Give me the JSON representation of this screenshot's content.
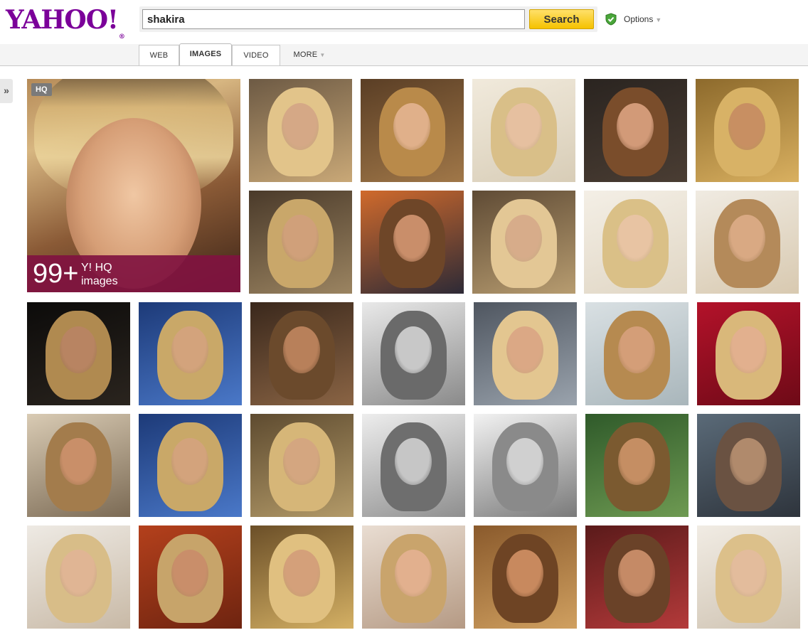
{
  "header": {
    "logo_text": "YAHOO!",
    "logo_reg": "®",
    "search": {
      "value": "shakira",
      "button_label": "Search"
    },
    "options_label": "Options"
  },
  "tabs": [
    {
      "label": "WEB",
      "active": false
    },
    {
      "label": "IMAGES",
      "active": true
    },
    {
      "label": "VIDEO",
      "active": false
    },
    {
      "label": "MORE",
      "active": false
    }
  ],
  "sidebar_toggle": "»",
  "hq_tile": {
    "badge": "HQ",
    "count": "99+",
    "label_line1": "Y! HQ",
    "label_line2": "images"
  },
  "colors": {
    "brand": "#7b0099",
    "search_button": "#f5c200",
    "hq_banner": "#801240"
  },
  "image_results": {
    "rows": [
      {
        "thumbs": [
          {
            "bg": [
              "#6d5a44",
              "#c9a877"
            ],
            "skin": "#d5a886",
            "hair": "#e2c48a"
          },
          {
            "bg": [
              "#5a3e25",
              "#a07748"
            ],
            "skin": "#e0b08a",
            "hair": "#b98a4a"
          },
          {
            "bg": [
              "#f1eadc",
              "#d8cdb7"
            ],
            "skin": "#e6c0a0",
            "hair": "#d9bf88"
          },
          {
            "bg": [
              "#2a2420",
              "#4a3d33"
            ],
            "skin": "#d29a78",
            "hair": "#7a4d2b"
          },
          {
            "bg": [
              "#8d6a2c",
              "#d9b060"
            ],
            "skin": "#c88f62",
            "hair": "#d8b266"
          }
        ]
      },
      {
        "thumbs": [
          {
            "bg": [
              "#4a3a2a",
              "#9b8461"
            ],
            "skin": "#d0a07a",
            "hair": "#c9a76a"
          },
          {
            "bg": [
              "#d06a2c",
              "#2d2a36"
            ],
            "skin": "#c98e6a",
            "hair": "#6e4628"
          },
          {
            "bg": [
              "#5f4b35",
              "#b79c70"
            ],
            "skin": "#d7ac8a",
            "hair": "#e3c795"
          },
          {
            "bg": [
              "#f4efe6",
              "#e0d6c4"
            ],
            "skin": "#e8c4a3",
            "hair": "#dac087"
          },
          {
            "bg": [
              "#f0ebe2",
              "#d8c9b0"
            ],
            "skin": "#d9a983",
            "hair": "#b48a5a"
          }
        ]
      },
      {
        "thumbs": [
          {
            "bg": [
              "#0c0b0a",
              "#2a241e"
            ],
            "skin": "#b88462",
            "hair": "#b08a50"
          },
          {
            "bg": [
              "#1d3a78",
              "#4a78c8"
            ],
            "skin": "#d3a37c",
            "hair": "#c9a868"
          },
          {
            "bg": [
              "#3a281c",
              "#8a6444"
            ],
            "skin": "#b8805a",
            "hair": "#6b4a2c"
          },
          {
            "bg": [
              "#e9e9e9",
              "#8a8a8a"
            ],
            "skin": "#c8c8c8",
            "hair": "#6a6a6a"
          },
          {
            "bg": [
              "#4f5660",
              "#9aa3ad"
            ],
            "skin": "#dba885",
            "hair": "#e3c690"
          },
          {
            "bg": [
              "#d9e0e3",
              "#a9b6bb"
            ],
            "skin": "#d49e78",
            "hair": "#b68a50"
          },
          {
            "bg": [
              "#b3122a",
              "#6e0a17"
            ],
            "skin": "#e2b08e",
            "hair": "#d9b87a"
          }
        ]
      },
      {
        "thumbs": [
          {
            "bg": [
              "#d9cbb4",
              "#7b6a54"
            ],
            "skin": "#c98f69",
            "hair": "#a37c4c"
          },
          {
            "bg": [
              "#1d3a78",
              "#4a78c8"
            ],
            "skin": "#d3a37c",
            "hair": "#c9a868"
          },
          {
            "bg": [
              "#5e4b30",
              "#b39a68"
            ],
            "skin": "#d4a680",
            "hair": "#d6b678"
          },
          {
            "bg": [
              "#ededed",
              "#8f8f8f"
            ],
            "skin": "#c6c6c6",
            "hair": "#6e6e6e"
          },
          {
            "bg": [
              "#f2f2f2",
              "#7a7a7a"
            ],
            "skin": "#d0d0d0",
            "hair": "#8a8a8a"
          },
          {
            "bg": [
              "#2f5a2a",
              "#6e9a52"
            ],
            "skin": "#c58e63",
            "hair": "#7b5a30"
          },
          {
            "bg": [
              "#5a6a78",
              "#2e343c"
            ],
            "skin": "#b08a6c",
            "hair": "#6a5242"
          }
        ]
      },
      {
        "thumbs": [
          {
            "bg": [
              "#eeeae4",
              "#c8b9a6"
            ],
            "skin": "#e0b594",
            "hair": "#d8bd88"
          },
          {
            "bg": [
              "#b4401c",
              "#6e2410"
            ],
            "skin": "#c98e6a",
            "hair": "#c7a46a"
          },
          {
            "bg": [
              "#6b4f28",
              "#d4b064"
            ],
            "skin": "#d4a07a",
            "hair": "#e0c080"
          },
          {
            "bg": [
              "#e9ddd2",
              "#b59a84"
            ],
            "skin": "#e2b08e",
            "hair": "#c9a46c"
          },
          {
            "bg": [
              "#8a5a2c",
              "#d0a060"
            ],
            "skin": "#c8895e",
            "hair": "#6e4424"
          },
          {
            "bg": [
              "#5a1a1a",
              "#b43a3a"
            ],
            "skin": "#c58a66",
            "hair": "#6a4228"
          },
          {
            "bg": [
              "#f1ece4",
              "#cfc3b2"
            ],
            "skin": "#e3bc9c",
            "hair": "#dcc08a"
          }
        ]
      }
    ]
  }
}
